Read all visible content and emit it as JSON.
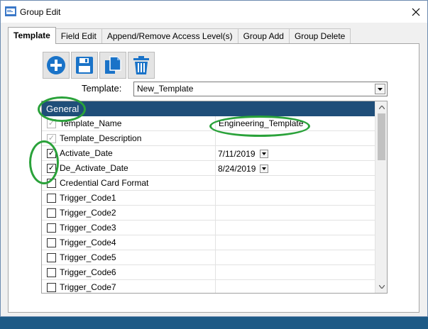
{
  "window": {
    "title": "Group Edit",
    "close_glyph": "✕"
  },
  "tabs": [
    {
      "label": "Template",
      "active": true
    },
    {
      "label": "Field Edit",
      "active": false
    },
    {
      "label": "Append/Remove Access Level(s)",
      "active": false
    },
    {
      "label": "Group Add",
      "active": false
    },
    {
      "label": "Group Delete",
      "active": false
    }
  ],
  "toolbar": {
    "buttons": [
      {
        "name": "add-button",
        "icon": "plus-circle-icon"
      },
      {
        "name": "save-button",
        "icon": "floppy-disk-icon"
      },
      {
        "name": "copy-button",
        "icon": "copy-documents-icon"
      },
      {
        "name": "delete-button",
        "icon": "trash-can-icon"
      }
    ],
    "accent_color": "#1a73c8"
  },
  "template_selector": {
    "label": "Template:",
    "value": "New_Template"
  },
  "grid": {
    "section_header": "General",
    "header_color": "#1f4e79",
    "rows": [
      {
        "label": "Template_Name",
        "checked": true,
        "disabled": true,
        "value": "Engineering_Template"
      },
      {
        "label": "Template_Description",
        "checked": true,
        "disabled": true,
        "value": ""
      },
      {
        "label": "Activate_Date",
        "checked": true,
        "disabled": false,
        "value": "7/11/2019",
        "is_date": true
      },
      {
        "label": "De_Activate_Date",
        "checked": true,
        "disabled": false,
        "value": "8/24/2019",
        "is_date": true
      },
      {
        "label": "Credential Card Format",
        "checked": false,
        "disabled": false,
        "value": ""
      },
      {
        "label": "Trigger_Code1",
        "checked": false,
        "disabled": false,
        "value": ""
      },
      {
        "label": "Trigger_Code2",
        "checked": false,
        "disabled": false,
        "value": ""
      },
      {
        "label": "Trigger_Code3",
        "checked": false,
        "disabled": false,
        "value": ""
      },
      {
        "label": "Trigger_Code4",
        "checked": false,
        "disabled": false,
        "value": ""
      },
      {
        "label": "Trigger_Code5",
        "checked": false,
        "disabled": false,
        "value": ""
      },
      {
        "label": "Trigger_Code6",
        "checked": false,
        "disabled": false,
        "value": ""
      },
      {
        "label": "Trigger_Code7",
        "checked": false,
        "disabled": false,
        "value": ""
      }
    ]
  },
  "annotation_color": "#2aa23a",
  "checkmark_glyph": "✓"
}
